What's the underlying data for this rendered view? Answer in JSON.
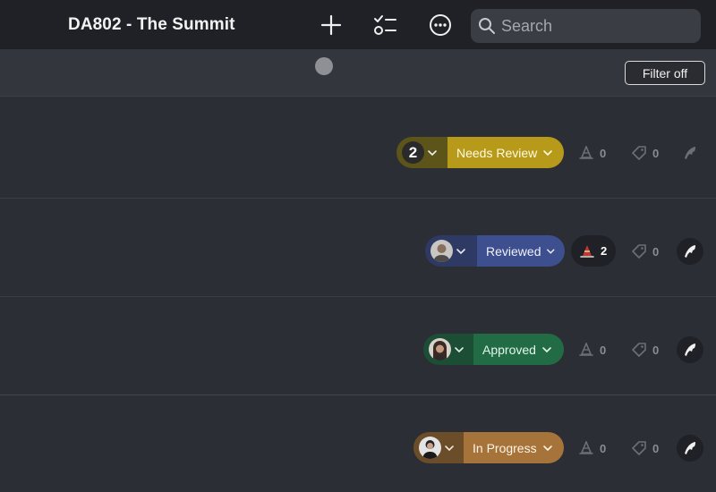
{
  "header": {
    "title": "DA802 - The Summit",
    "search_placeholder": "Search",
    "icons": [
      "plus-icon",
      "checklist-icon",
      "more-icon",
      "search-icon"
    ]
  },
  "toolbar": {
    "filter_label": "Filter off"
  },
  "rows": [
    {
      "assignee_count": "2",
      "status": "Needs Review",
      "status_color": "#b89a1a",
      "assignee_bg": "#5c5418",
      "notes": "0",
      "tags": "0"
    },
    {
      "status": "Reviewed",
      "status_color": "#3e4f8f",
      "assignee_bg": "#2e3a63",
      "notes": "2",
      "tags": "0"
    },
    {
      "status": "Approved",
      "status_color": "#226c45",
      "assignee_bg": "#1b4e35",
      "notes": "0",
      "tags": "0"
    },
    {
      "status": "In Progress",
      "status_color": "#a6733a",
      "assignee_bg": "#6b4d2a",
      "notes": "0",
      "tags": "0"
    }
  ]
}
